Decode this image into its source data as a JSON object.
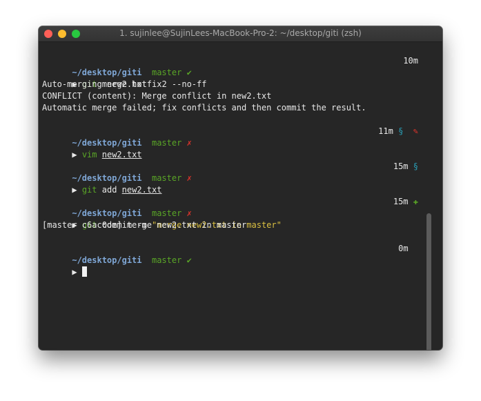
{
  "window": {
    "title": "1. sujinlee@SujinLees-MacBook-Pro-2: ~/desktop/giti (zsh)"
  },
  "blocks": [
    {
      "prompt": {
        "path": "~/desktop/giti",
        "branch": "master",
        "status": "✔",
        "time": "10m",
        "indicators": []
      },
      "command": {
        "arrow": "▶",
        "program": "git",
        "args": "merge hotfix2 --no-ff"
      },
      "output": [
        "Auto-merging new2.txt",
        "CONFLICT (content): Merge conflict in new2.txt",
        "Automatic merge failed; fix conflicts and then commit the result."
      ]
    },
    {
      "prompt": {
        "path": "~/desktop/giti",
        "branch": "master",
        "status": "✗",
        "time": "11m",
        "indicators": [
          "§",
          "✎"
        ]
      },
      "command": {
        "arrow": "▶",
        "program": "vim",
        "args": "new2.txt"
      },
      "output": []
    },
    {
      "prompt": {
        "path": "~/desktop/giti",
        "branch": "master",
        "status": "✗",
        "time": "15m",
        "indicators": [
          "§"
        ]
      },
      "command": {
        "arrow": "▶",
        "program": "git",
        "args_prefix": "add",
        "args": "new2.txt"
      },
      "output": []
    },
    {
      "prompt": {
        "path": "~/desktop/giti",
        "branch": "master",
        "status": "✗",
        "time": "15m",
        "indicators": [
          "✚"
        ]
      },
      "command": {
        "arrow": "▶",
        "program": "git",
        "args_prefix": "commit -m",
        "args": "\"merge new2.txt in master\""
      },
      "output": [
        "[master c6ac0de] merge new2.txt in master"
      ]
    },
    {
      "prompt": {
        "path": "~/desktop/giti",
        "branch": "master",
        "status": "✔",
        "time": "0m",
        "indicators": []
      },
      "command": {
        "arrow": "▶",
        "program": "",
        "args": ""
      },
      "output": []
    }
  ],
  "colors": {
    "background": "#262626",
    "path": "#7fa7d6",
    "branch": "#5aa626",
    "error": "#e2342b",
    "string": "#dcc142",
    "stash": "#29a0b8"
  }
}
